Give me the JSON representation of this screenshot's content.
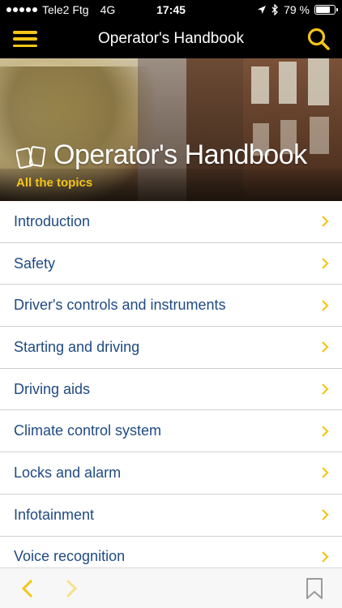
{
  "status_bar": {
    "carrier": "Tele2 Ftg",
    "network": "4G",
    "time": "17:45",
    "battery": "79 %",
    "battery_level": 0.79,
    "icons": [
      "signal-dots",
      "location-arrow-icon",
      "bluetooth-icon",
      "battery-icon"
    ]
  },
  "nav": {
    "title": "Operator's Handbook",
    "menu_icon": "hamburger-menu-icon",
    "search_icon": "search-icon"
  },
  "hero": {
    "title": "Operator's Handbook",
    "subtitle": "All the topics",
    "logo_icon": "pages-logo-icon"
  },
  "topics": [
    {
      "label": "Introduction"
    },
    {
      "label": "Safety"
    },
    {
      "label": "Driver's controls and instruments"
    },
    {
      "label": "Starting and driving"
    },
    {
      "label": "Driving aids"
    },
    {
      "label": "Climate control system"
    },
    {
      "label": "Locks and alarm"
    },
    {
      "label": "Infotainment"
    },
    {
      "label": "Voice recognition"
    }
  ],
  "bottom_bar": {
    "back_icon": "chevron-left-icon",
    "forward_icon": "chevron-right-icon",
    "bookmark_icon": "bookmark-icon"
  },
  "colors": {
    "accent": "#f5c518",
    "link": "#1f4a82",
    "bar_background": "#000000",
    "divider": "#cfcfcf"
  }
}
